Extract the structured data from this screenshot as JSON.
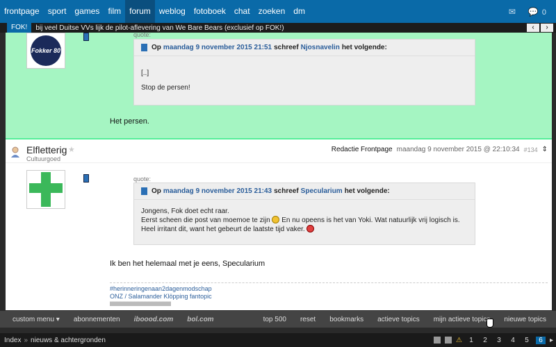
{
  "nav": {
    "items": [
      "frontpage",
      "sport",
      "games",
      "film",
      "forum",
      "weblog",
      "fotoboek",
      "chat",
      "zoeken",
      "dm"
    ],
    "active": "forum",
    "messages_count": "0"
  },
  "ticker": {
    "tag": "FOK!",
    "text": "bij veel Duitse VVs  lijk de pilot-aflevering van We Bare Bears (exclusief op FOK!)"
  },
  "post1": {
    "avatar_text": "Fokker 80",
    "quote_label": "quote:",
    "quote_header": {
      "prefix": "Op",
      "date": "maandag 9 november 2015 21:51",
      "mid": "schreef",
      "author": "Njosnavelin",
      "suffix": "het volgende:"
    },
    "quote_lines": [
      "[..]",
      "Stop de persen!"
    ],
    "text": "Het persen."
  },
  "post2": {
    "username": "Elfletterig",
    "user_title": "Cultuurgoed",
    "editor": "Redactie Frontpage",
    "date": "maandag 9 november 2015 @ 22:10:34",
    "post_number": "#134",
    "quote_label": "quote:",
    "quote_header": {
      "prefix": "Op",
      "date": "maandag 9 november 2015 21:43",
      "mid": "schreef",
      "author": "Specularium",
      "suffix": "het volgende:"
    },
    "quote_line1": "Jongens, Fok doet echt raar.",
    "quote_line2a": "Eerst scheen die post van moemoe te zijn",
    "quote_line2b": "En nu opeens is het van Yoki. Wat natuurlijk vrij logisch is.",
    "quote_line3": "Heel irritant dit, want het gebeurt de laatste tijd vaker.",
    "text": "Ik ben het helemaal met je eens, Specularium",
    "sig1": "#herinneringenaan2dagenmodschap",
    "sig2": "ONZ / Salamander Klöpping fantopic",
    "sig3": "llllllllllllllllllllllllllllllllllllllllllll"
  },
  "bottombar": {
    "left": [
      "custom menu ▾",
      "abonnementen",
      "iboood.com",
      "bol.com"
    ],
    "right": [
      "top 500",
      "reset",
      "bookmarks",
      "actieve topics",
      "mijn actieve topics",
      "nieuwe topics"
    ]
  },
  "footer": {
    "crumbs": [
      "Index",
      "nieuws & achtergronden"
    ],
    "pages": [
      "1",
      "2",
      "3",
      "4",
      "5",
      "6"
    ],
    "active_page": "6"
  }
}
